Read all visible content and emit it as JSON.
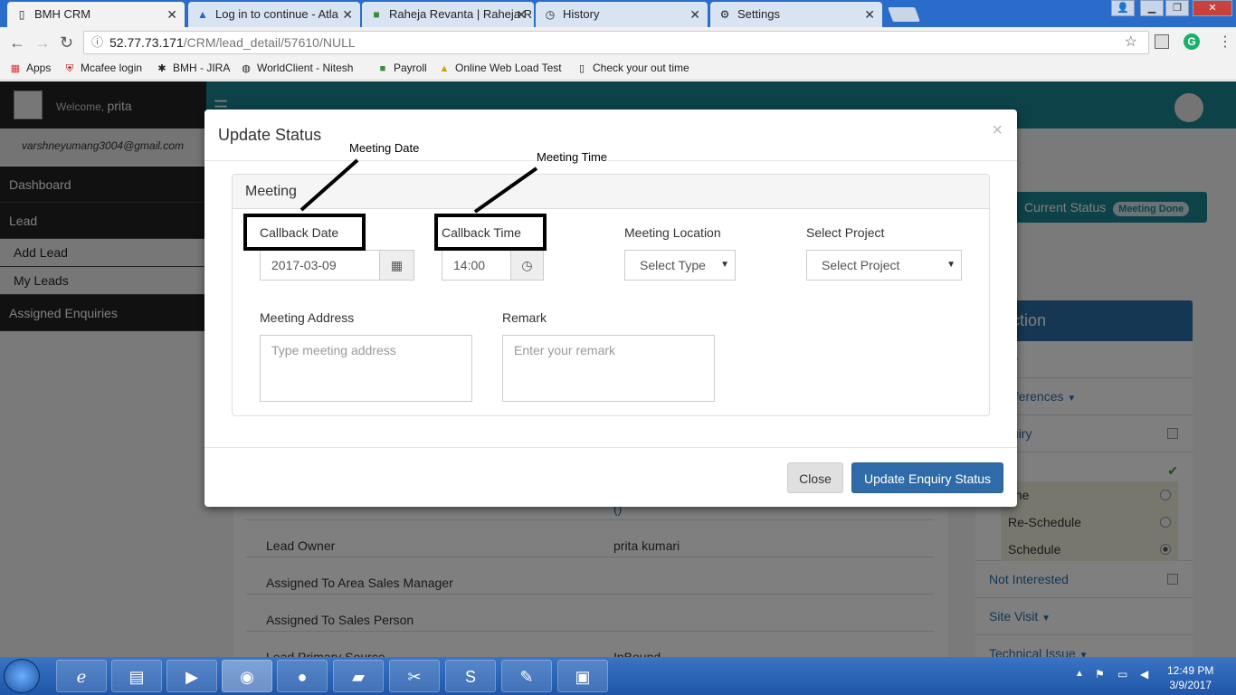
{
  "browser": {
    "tabs": [
      {
        "title": "BMH CRM",
        "icon": "document-icon"
      },
      {
        "title": "Log in to continue - Atla",
        "icon": "atlassian-icon"
      },
      {
        "title": "Raheja Revanta | Raheja R",
        "icon": "raheja-icon"
      },
      {
        "title": "History",
        "icon": "history-icon"
      },
      {
        "title": "Settings",
        "icon": "gear-icon"
      }
    ],
    "url_host": "52.77.73.171",
    "url_path": "/CRM/lead_detail/57610/NULL",
    "bookmarks": [
      "Apps",
      "Mcafee login",
      "BMH - JIRA",
      "WorldClient - Nitesh",
      "Payroll",
      "Online Web Load Test",
      "Check your out time"
    ]
  },
  "sidebar": {
    "welcome_prefix": "Welcome,",
    "user": "prita",
    "email": "varshneyumang3004@gmail.com",
    "items": [
      "Dashboard",
      "Lead"
    ],
    "sub_items": [
      "Add Lead",
      "My Leads"
    ],
    "assigned": "Assigned Enquiries"
  },
  "content": {
    "rows": [
      {
        "label": "Lead Owner",
        "value": "prita kumari"
      },
      {
        "label": "Assigned To Area Sales Manager",
        "value": ""
      },
      {
        "label": "Assigned To Sales Person",
        "value": ""
      },
      {
        "label": "Lead Primary Source",
        "value": "InBound"
      }
    ],
    "partial_value": "()"
  },
  "right_panel": {
    "current_status_label": "Current Status",
    "current_status_value": "Meeting Done",
    "lead_action_title": "d Action",
    "items": {
      "structure": "ure",
      "references": "re references",
      "enquiry": "Enquiry",
      "meeting": "ing",
      "not_interested": "Not Interested",
      "site_visit": "Site Visit",
      "technical_issue": "Technical Issue"
    },
    "meeting_options": [
      "one",
      "Re-Schedule",
      "Schedule"
    ]
  },
  "modal": {
    "title": "Update Status",
    "close_symbol": "×",
    "panel_title": "Meeting",
    "callback_date_label": "Callback Date",
    "callback_date_value": "2017-03-09",
    "callback_time_label": "Callback Time",
    "callback_time_value": "14:00",
    "meeting_location_label": "Meeting Location",
    "meeting_location_value": "Select Type",
    "select_project_label": "Select Project",
    "select_project_value": "Select Project",
    "meeting_address_label": "Meeting Address",
    "meeting_address_placeholder": "Type meeting address",
    "remark_label": "Remark",
    "remark_placeholder": "Enter your remark",
    "close_button": "Close",
    "update_button": "Update Enquiry Status"
  },
  "annotations": {
    "meeting_date": "Meeting Date",
    "meeting_time": "Meeting Time"
  },
  "taskbar": {
    "time": "12:49 PM",
    "date": "3/9/2017"
  }
}
